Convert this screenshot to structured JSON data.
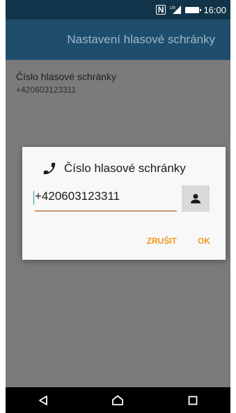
{
  "status_bar": {
    "time": "16:00",
    "nfc_label": "N",
    "icons": [
      "nfc-icon",
      "lte-signal-icon",
      "battery-icon"
    ]
  },
  "app_bar": {
    "title": "Nastavení hlasové schránky"
  },
  "preference": {
    "title": "Číslo hlasové schránky",
    "summary": "+420603123311"
  },
  "dialog": {
    "title": "Číslo hlasové schránky",
    "title_icon": "phone-icon",
    "input_value": "+420603123311",
    "contact_icon": "contact-person-icon",
    "cancel_label": "ZRUŠIT",
    "ok_label": "OK",
    "accent_color": "#f39621"
  },
  "nav_bar": {
    "buttons": [
      "back-icon",
      "home-icon",
      "recents-icon"
    ]
  }
}
